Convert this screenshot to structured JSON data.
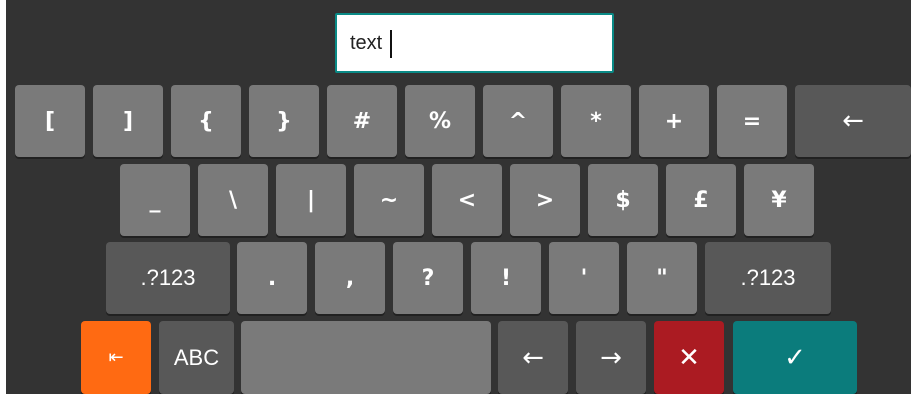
{
  "input": {
    "value": "text"
  },
  "colors": {
    "background": "#333333",
    "key_light": "#7a7a7a",
    "key_dark": "#585858",
    "accent_orange": "#ff6a12",
    "cancel_red": "#ab1b22",
    "confirm_teal": "#0b7c7c",
    "input_border": "#0a8a86"
  },
  "keys": {
    "row1": [
      "[",
      "]",
      "{",
      "}",
      "#",
      "%",
      "^",
      "*",
      "+",
      "=",
      "←"
    ],
    "row2": [
      "_",
      "\\",
      "|",
      "~",
      "<",
      ">",
      "$",
      "£",
      "¥"
    ],
    "row3": [
      ".?123",
      ".",
      ",",
      "?",
      "!",
      "'",
      "\"",
      ".?123"
    ],
    "row4": {
      "tab_icon": "⇤",
      "abc": "ABC",
      "space": "",
      "left_arrow": "←",
      "right_arrow": "→",
      "cancel_icon": "✕",
      "confirm_icon": "✓"
    }
  },
  "icons": {
    "backspace": "backspace-icon",
    "tab": "tab-left-icon",
    "left": "arrow-left-icon",
    "right": "arrow-right-icon",
    "cancel": "close-icon",
    "confirm": "check-icon"
  }
}
